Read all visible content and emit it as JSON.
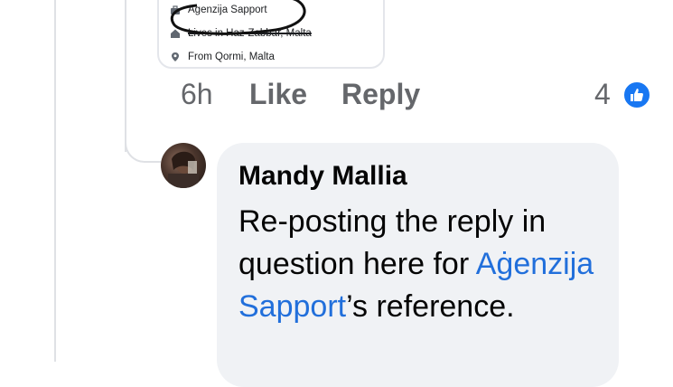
{
  "profile_card": {
    "work": "Agenzija Sapport",
    "lives": "Lives in Haz-Zabbar, Malta",
    "from": "From Qormi, Malta"
  },
  "comment_actions": {
    "time": "6h",
    "like_label": "Like",
    "reply_label": "Reply",
    "reaction_count": "4",
    "reaction_icon": "thumbs-up-icon"
  },
  "reply": {
    "author": "Mandy Mallia",
    "text_before": "Re-posting the reply in question here for ",
    "mention": "Aġenzija Sapport",
    "text_after": "’s reference."
  },
  "colors": {
    "link": "#216fdb",
    "bubble": "#f0f2f5",
    "meta": "#65676b",
    "like_blue": "#1877f2"
  }
}
